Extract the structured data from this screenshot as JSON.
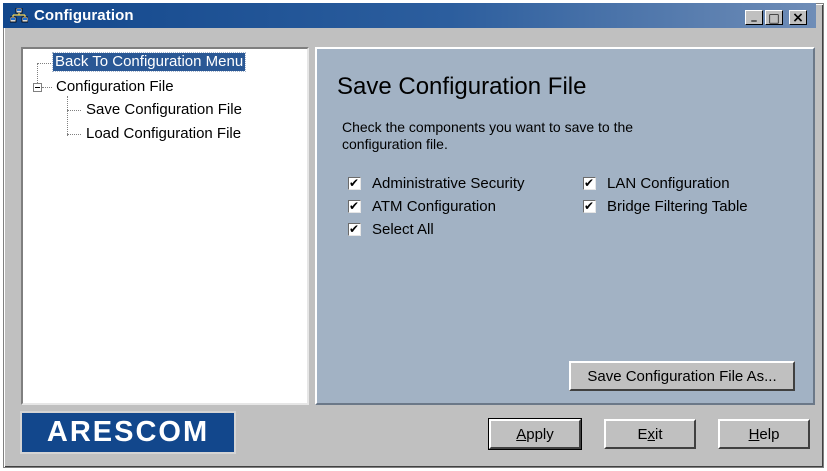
{
  "window": {
    "title": "Configuration",
    "title_icon": "network-computers-icon",
    "controls": {
      "minimize": "_",
      "maximize": "□",
      "close": "×"
    }
  },
  "tree": {
    "items": [
      {
        "label": "Back To Configuration Menu",
        "selected": true
      },
      {
        "label": "Configuration File",
        "expanded": true
      },
      {
        "label": "Save Configuration File"
      },
      {
        "label": "Load Configuration File"
      }
    ]
  },
  "panel": {
    "title": "Save Configuration File",
    "description": "Check the components you want to save to the configuration file.",
    "checkboxes": [
      {
        "label": "Administrative Security",
        "checked": true
      },
      {
        "label": "ATM Configuration",
        "checked": true
      },
      {
        "label": "Select All",
        "checked": true
      },
      {
        "label": "LAN Configuration",
        "checked": true
      },
      {
        "label": "Bridge Filtering Table",
        "checked": true
      }
    ],
    "save_as_label": "Save Configuration File As..."
  },
  "footer": {
    "logo_text": "ARESCOM",
    "apply": {
      "mnemonic": "A",
      "rest": "pply"
    },
    "exit": {
      "pre": "E",
      "mnemonic": "x",
      "rest": "it"
    },
    "help": {
      "mnemonic": "H",
      "rest": "elp"
    }
  },
  "colors": {
    "titlebar_start": "#12478c",
    "panel_bg": "#a2b2c4",
    "window_bg": "#c0c0c0",
    "logo_bg": "#12478c",
    "selection_bg": "#2a5895"
  }
}
